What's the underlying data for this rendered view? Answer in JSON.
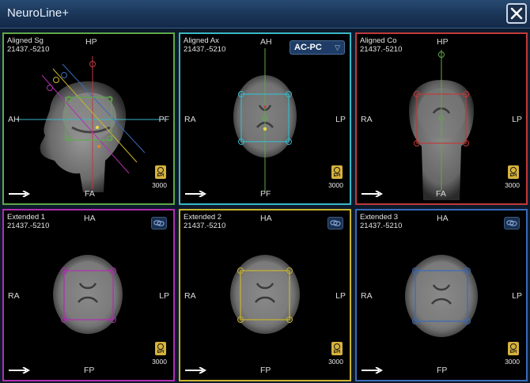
{
  "window": {
    "title": "NeuroLine+"
  },
  "colors": {
    "sg": "#5fa84a",
    "ax": "#3ab8c8",
    "co": "#c03a3a",
    "ext1": "#b02eb0",
    "ext2": "#c8b430",
    "ext3": "#3a6ab8"
  },
  "panels": [
    {
      "name": "Aligned Sg",
      "id": "21437.-5210",
      "top": "HP",
      "bottom": "FA",
      "left": "AH",
      "right": "PF",
      "tr": "3000",
      "badge": "EPI"
    },
    {
      "name": "Aligned Ax",
      "id": "21437.-5210",
      "top": "AH",
      "bottom": "PF",
      "left": "RA",
      "right": "LP",
      "tr": "3000",
      "badge": "EPI",
      "dropdown": "AC-PC"
    },
    {
      "name": "Aligned Co",
      "id": "21437.-5210",
      "top": "HP",
      "bottom": "FA",
      "left": "RA",
      "right": "LP",
      "tr": "3000",
      "badge": "EPI"
    },
    {
      "name": "Extended 1",
      "id": "21437.-5210",
      "top": "HA",
      "bottom": "FP",
      "left": "RA",
      "right": "LP",
      "tr": "3000",
      "badge": "EPI"
    },
    {
      "name": "Extended 2",
      "id": "21437.-5210",
      "top": "HA",
      "bottom": "FP",
      "left": "RA",
      "right": "LP",
      "tr": "3000",
      "badge": "EPI"
    },
    {
      "name": "Extended 3",
      "id": "21437.-5210",
      "top": "HA",
      "bottom": "FP",
      "left": "RA",
      "right": "LP",
      "tr": "3000",
      "badge": "EPI"
    }
  ]
}
